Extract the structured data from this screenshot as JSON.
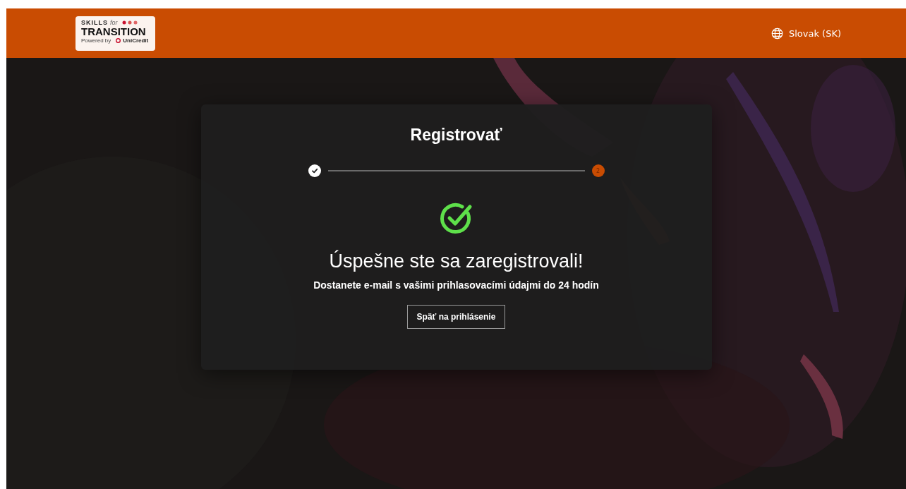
{
  "header": {
    "logo": {
      "line_1": "SKILLS",
      "line_1_suffix": "for",
      "line_2": "TRANSITION",
      "powered_by": "Powered by",
      "brand": "UniCredit"
    },
    "language": "Slovak (SK)"
  },
  "card": {
    "title": "Registrovať",
    "steps": [
      {
        "kind": "done"
      },
      {
        "kind": "current",
        "number": "2"
      }
    ],
    "heading": "Úspešne ste sa zaregistrovali!",
    "message": "Dostanete e-mail s vašimi prihlasovacími údajmi do 24 hodín",
    "button": "Späť na prihlásenie"
  }
}
